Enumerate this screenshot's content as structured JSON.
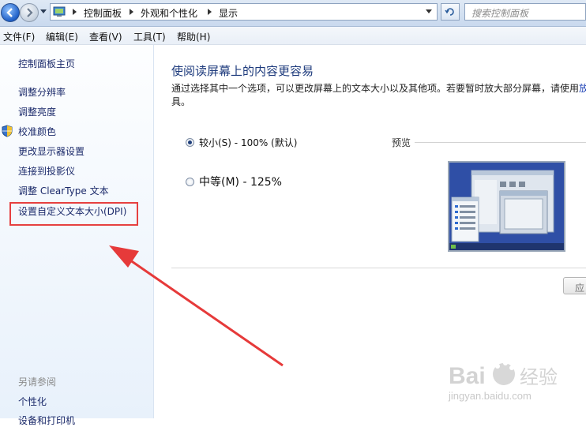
{
  "address_bar": {
    "crumbs": [
      "控制面板",
      "外观和个性化",
      "显示"
    ],
    "search_placeholder": "搜索控制面板"
  },
  "menu": [
    "文件(F)",
    "编辑(E)",
    "查看(V)",
    "工具(T)",
    "帮助(H)"
  ],
  "sidebar": {
    "home": "控制面板主页",
    "links": [
      "调整分辨率",
      "调整亮度",
      "校准颜色",
      "更改显示器设置",
      "连接到投影仪",
      "调整 ClearType 文本",
      "设置自定义文本大小(DPI)"
    ],
    "see_also_label": "另请参阅",
    "see_also": [
      "个性化",
      "设备和打印机"
    ]
  },
  "main": {
    "heading": "使阅读屏幕上的内容更容易",
    "description_line1": "通过选择其中一个选项，可以更改屏幕上的文本大小以及其他项。若要暂时放大部分屏幕，请使用",
    "description_link": "放",
    "description_line2": "具。",
    "options": [
      {
        "label": "较小(S) - 100% (默认)",
        "selected": true
      },
      {
        "label": "中等(M) - 125%",
        "selected": false
      }
    ],
    "preview_label": "预览",
    "apply_button": "应"
  },
  "watermark": "jingyan.baidu.com",
  "colors": {
    "highlight_box": "#e64040",
    "arrow": "#e63a3a",
    "link": "#1c2b6b"
  }
}
